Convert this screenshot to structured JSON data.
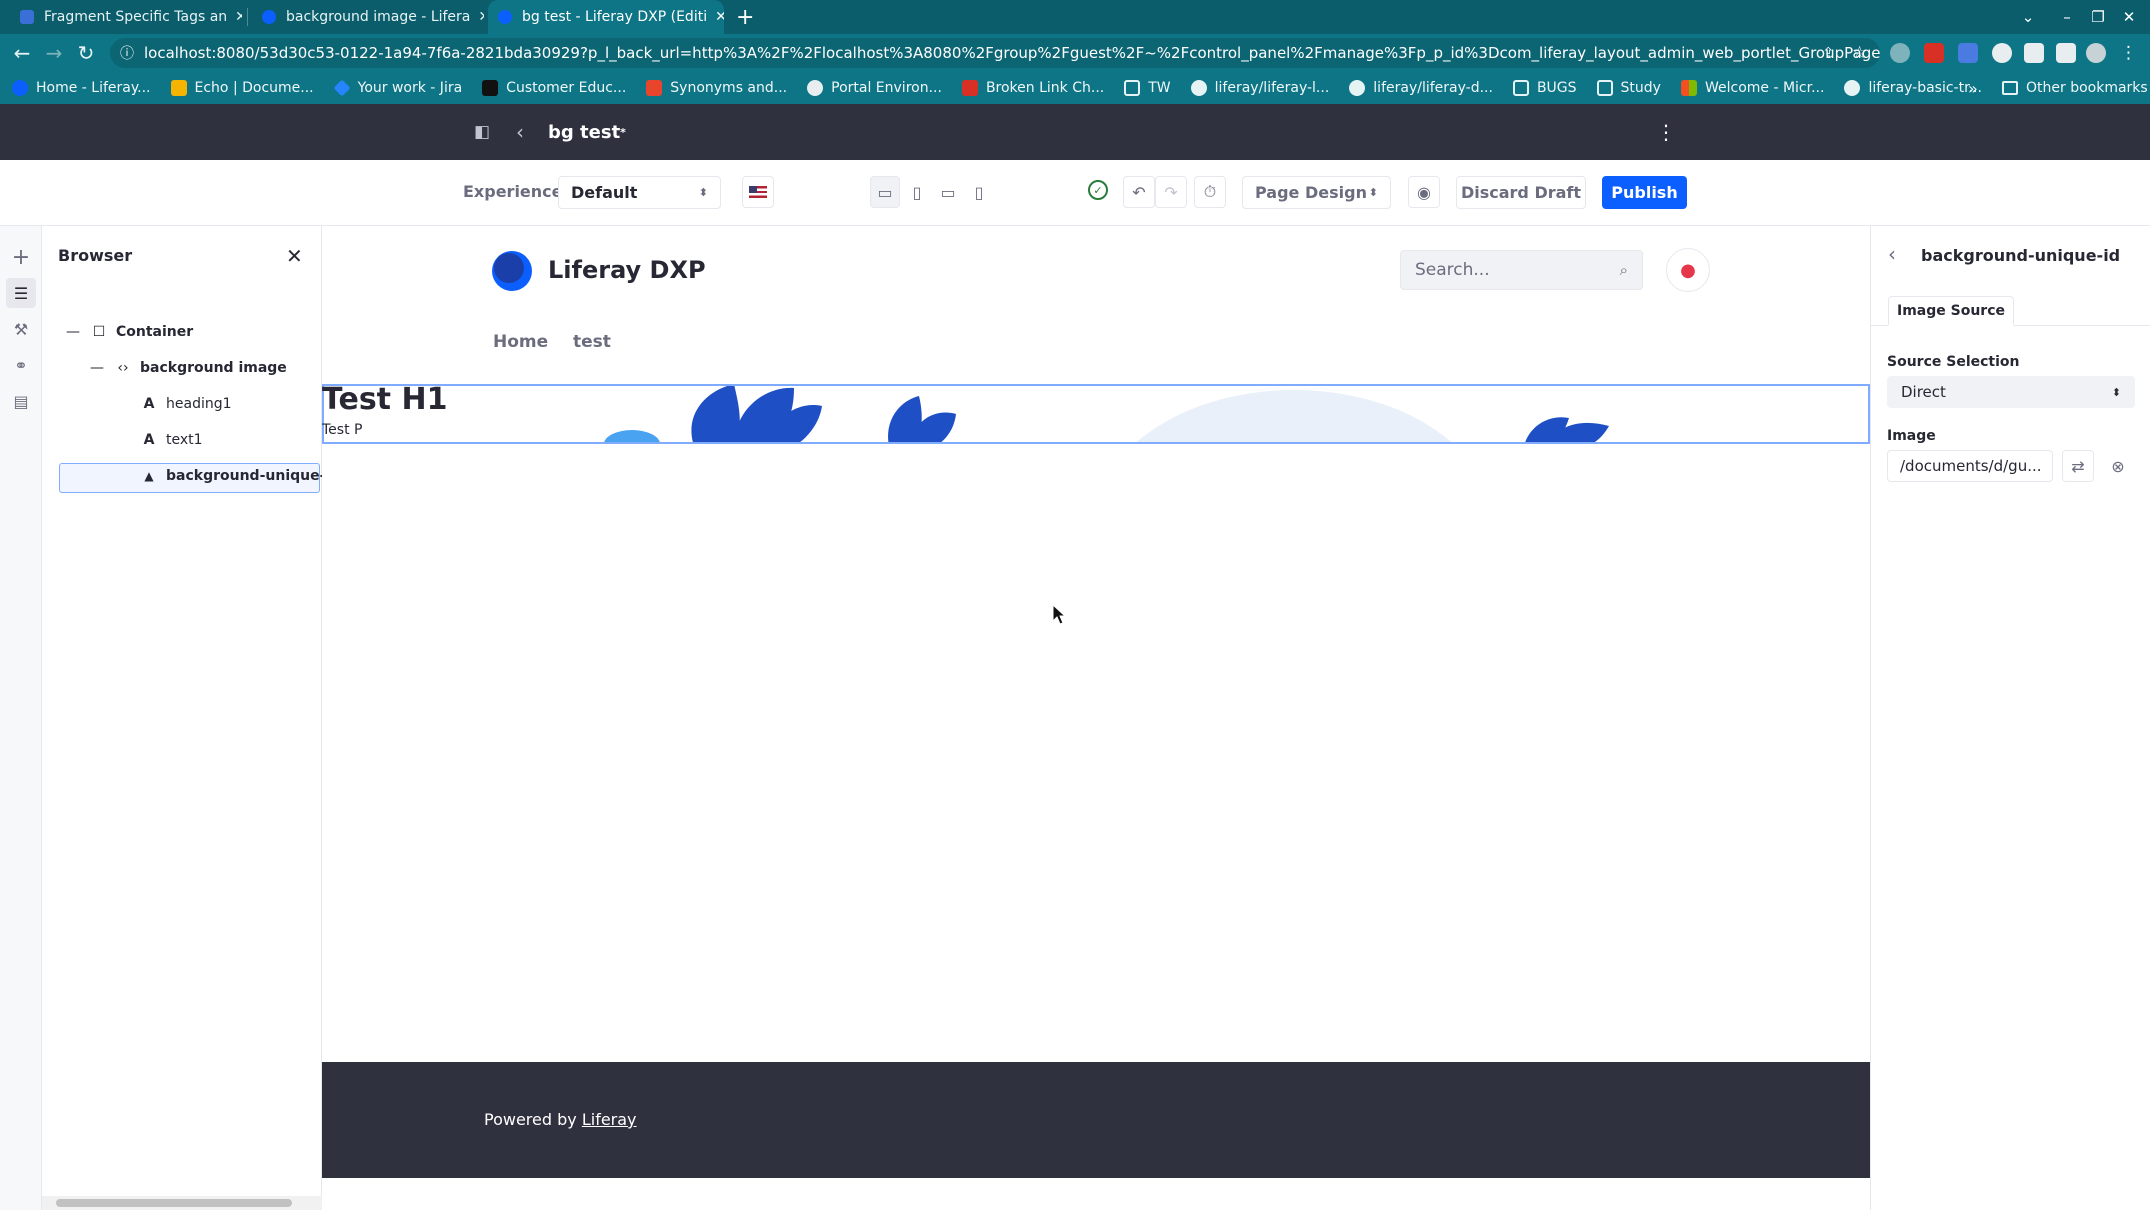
{
  "browser": {
    "tabs": [
      {
        "title": "Fragment Specific Tags an",
        "active": false
      },
      {
        "title": "background image - Lifera",
        "active": false
      },
      {
        "title": "bg test - Liferay DXP (Editi",
        "active": true
      }
    ],
    "new_tab": "+",
    "url": "localhost:8080/53d30c53-0122-1a94-7f6a-2821bda30929?p_l_back_url=http%3A%2F%2Flocalhost%3A8080%2Fgroup%2Fguest%2F~%2Fcontrol_panel%2Fmanage%3Fp_p_id%3Dcom_liferay_layout_admin_web_portlet_GroupPagesP...",
    "bookmarks": [
      "Home - Liferay...",
      "Echo | Docume...",
      "Your work - Jira",
      "Customer Educ...",
      "Synonyms and...",
      "Portal Environ...",
      "Broken Link Ch...",
      "TW",
      "liferay/liferay-l...",
      "liferay/liferay-d...",
      "BUGS",
      "Study",
      "Welcome - Micr...",
      "liferay-basic-tr..."
    ],
    "bookmarks_overflow": "»",
    "other_bookmarks": "Other bookmarks"
  },
  "control_bar": {
    "page_title": "bg test",
    "unsaved_marker": "*"
  },
  "edit_bar": {
    "experience_label": "Experience",
    "experience_value": "Default",
    "mode_value": "Page Design",
    "discard_label": "Discard Draft",
    "publish_label": "Publish"
  },
  "browser_panel": {
    "title": "Browser",
    "tree": [
      {
        "label": "Container",
        "toggle": "—",
        "icon": "☐"
      },
      {
        "label": "background image",
        "toggle": "—",
        "icon": "‹›"
      },
      {
        "label": "heading1",
        "icon": "A"
      },
      {
        "label": "text1",
        "icon": "A"
      },
      {
        "label": "background-unique-id",
        "icon": "▲",
        "selected": true
      }
    ]
  },
  "site": {
    "name": "Liferay DXP",
    "search_placeholder": "Search...",
    "nav": [
      "Home",
      "test"
    ],
    "fragment_heading": "Test H1",
    "fragment_text": "Test P",
    "footer_prefix": "Powered by",
    "footer_link": "Liferay"
  },
  "config_panel": {
    "title": "background-unique-id",
    "tab": "Image Source",
    "source_label": "Source Selection",
    "source_value": "Direct",
    "image_label": "Image",
    "image_value": "/documents/d/gu..."
  },
  "colors": {
    "chrome": "#0d7586",
    "control_bar": "#30313f",
    "primary": "#0b5fff",
    "selection": "#80acff"
  }
}
